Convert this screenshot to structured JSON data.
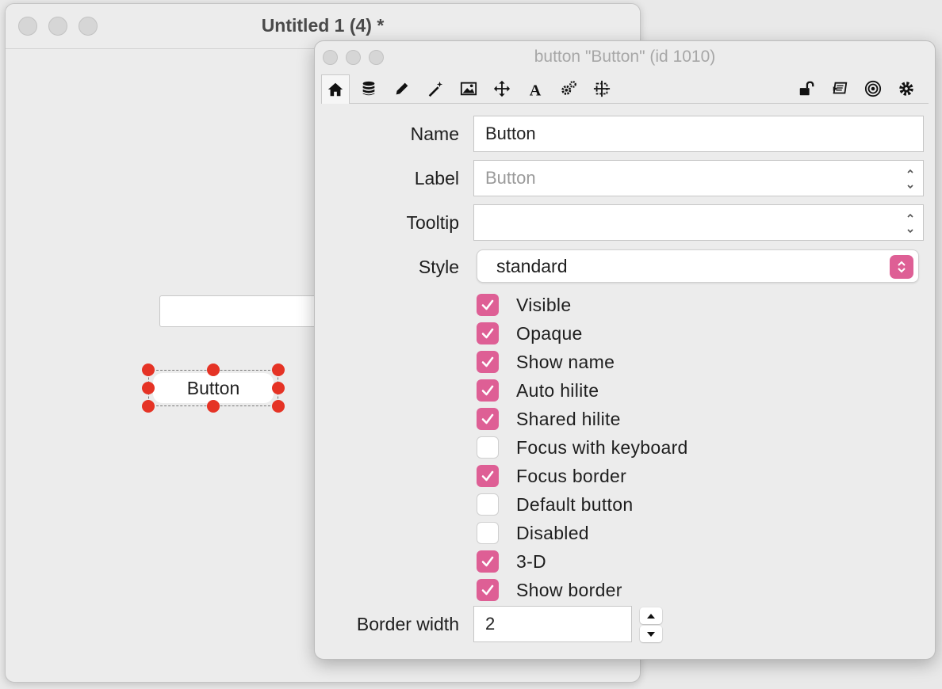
{
  "back_window": {
    "title": "Untitled 1 (4) *",
    "button_object_label": "Button"
  },
  "inspector": {
    "title": "button \"Button\" (id 1010)",
    "toolbar": {
      "left_icons": [
        "home-icon",
        "database-icon",
        "pencil-icon",
        "magic-wand-icon",
        "image-icon",
        "move-icon",
        "text-icon",
        "gears-icon",
        "geometry-icon"
      ],
      "right_icons": [
        "unlock-icon",
        "message-icon",
        "target-icon",
        "gear-icon"
      ],
      "active_tab": "home-icon"
    },
    "name": {
      "label": "Name",
      "value": "Button"
    },
    "label_field": {
      "label": "Label",
      "placeholder": "Button",
      "value": ""
    },
    "tooltip": {
      "label": "Tooltip",
      "value": ""
    },
    "style": {
      "label": "Style",
      "value": "standard"
    },
    "checkboxes": [
      {
        "label": "Visible",
        "checked": true
      },
      {
        "label": "Opaque",
        "checked": true
      },
      {
        "label": "Show name",
        "checked": true
      },
      {
        "label": "Auto hilite",
        "checked": true
      },
      {
        "label": "Shared hilite",
        "checked": true
      },
      {
        "label": "Focus with keyboard",
        "checked": false
      },
      {
        "label": "Focus border",
        "checked": true
      },
      {
        "label": "Default button",
        "checked": false
      },
      {
        "label": "Disabled",
        "checked": false
      },
      {
        "label": "3-D",
        "checked": true
      },
      {
        "label": "Show border",
        "checked": true
      }
    ],
    "border_width": {
      "label": "Border width",
      "value": "2"
    }
  },
  "colors": {
    "accent": "#de5f95",
    "selection_handle": "#e53325"
  }
}
